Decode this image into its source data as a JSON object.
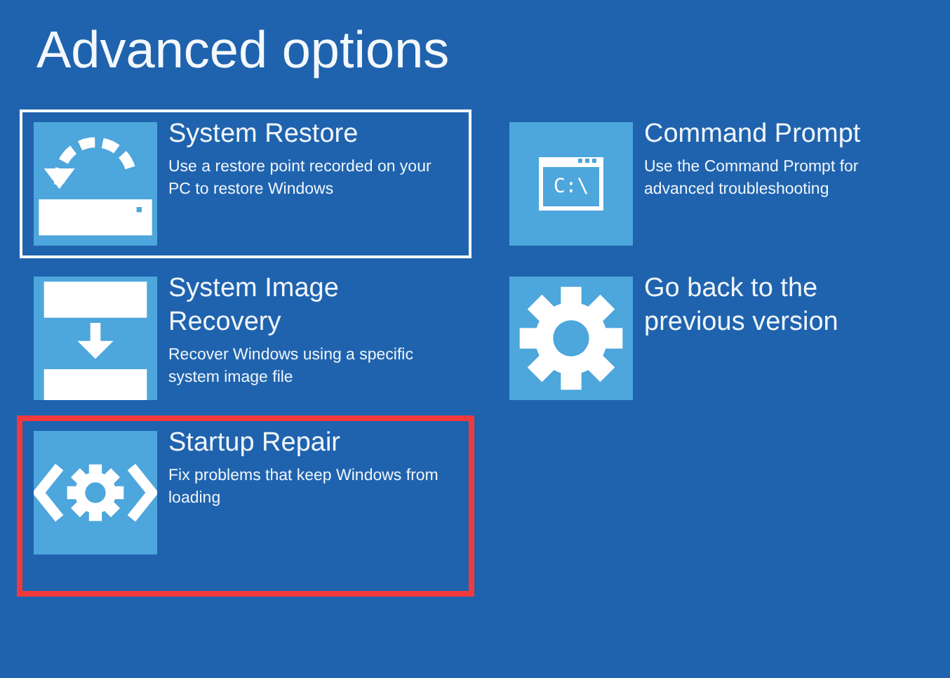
{
  "title": "Advanced options",
  "options": [
    {
      "kind": "restore",
      "title": "System Restore",
      "description": "Use a restore point recorded on your PC to restore Windows",
      "selected": true,
      "highlighted": false
    },
    {
      "kind": "command",
      "icon_text": "C:\\",
      "title": "Command Prompt",
      "description": "Use the Command Prompt for advanced troubleshooting",
      "selected": false,
      "highlighted": false
    },
    {
      "kind": "image",
      "title": "System Image Recovery",
      "description": "Recover Windows using a specific system image file",
      "selected": false,
      "highlighted": false
    },
    {
      "kind": "gear",
      "title": "Go back to the previous version",
      "selected": false,
      "highlighted": false
    },
    {
      "kind": "repair",
      "title": "Startup Repair",
      "description": "Fix problems that keep Windows from loading",
      "selected": false,
      "highlighted": true
    }
  ]
}
